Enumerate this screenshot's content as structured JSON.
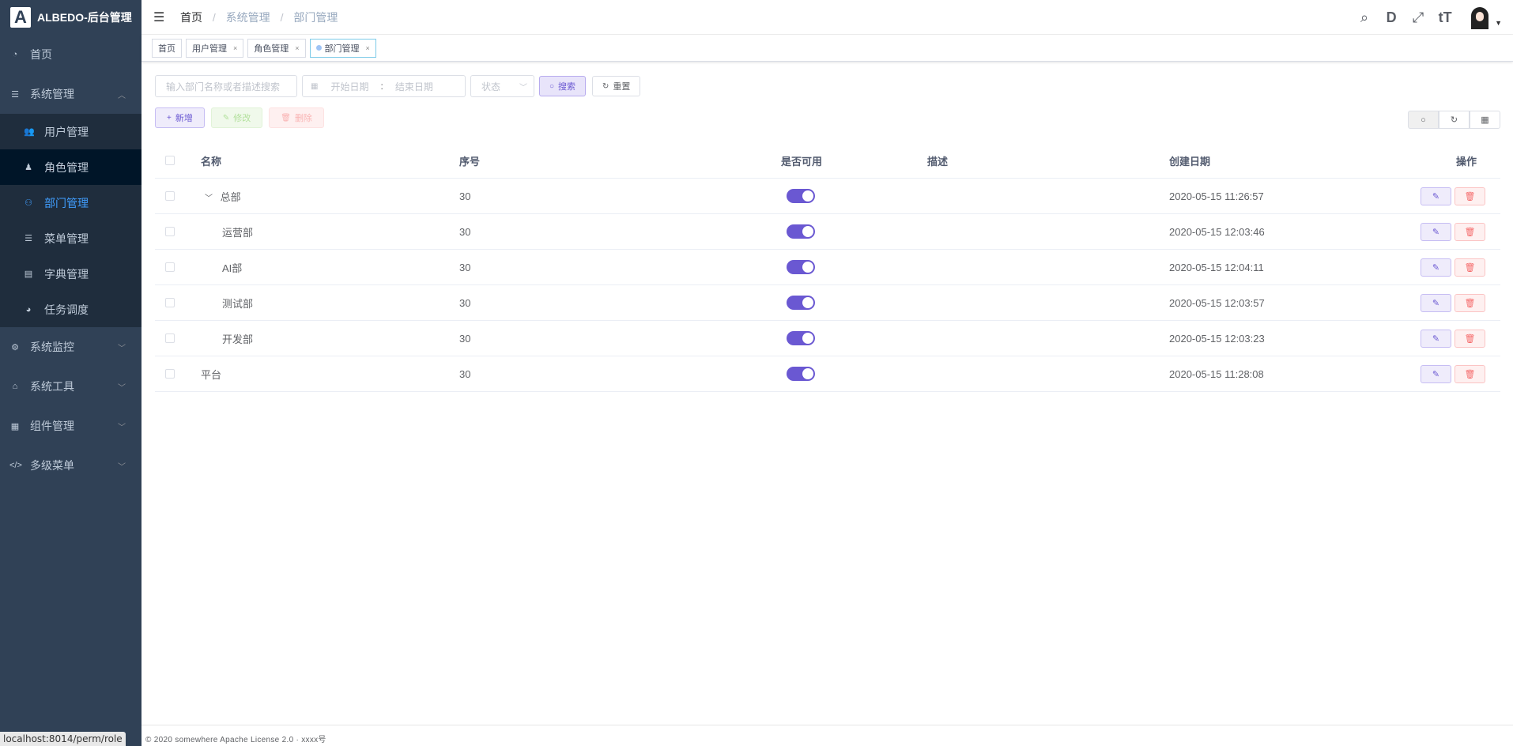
{
  "app": {
    "logo_letter": "A",
    "title": "ALBEDO-后台管理"
  },
  "sidebar": {
    "items": [
      {
        "label": "首页",
        "icon": "dashboard-icon"
      },
      {
        "label": "系统管理",
        "icon": "system-icon",
        "expanded": true,
        "children": [
          {
            "label": "用户管理",
            "icon": "user-icon"
          },
          {
            "label": "角色管理",
            "icon": "role-icon"
          },
          {
            "label": "部门管理",
            "icon": "dept-icon",
            "active": true
          },
          {
            "label": "菜单管理",
            "icon": "menu-icon"
          },
          {
            "label": "字典管理",
            "icon": "dict-icon"
          },
          {
            "label": "任务调度",
            "icon": "timer-icon"
          }
        ]
      },
      {
        "label": "系统监控",
        "icon": "monitor-icon"
      },
      {
        "label": "系统工具",
        "icon": "tool-icon"
      },
      {
        "label": "组件管理",
        "icon": "component-icon"
      },
      {
        "label": "多级菜单",
        "icon": "code-icon"
      }
    ]
  },
  "status_url": "localhost:8014/perm/role",
  "breadcrumb": {
    "home": "首页",
    "sep": "/",
    "level1": "系统管理",
    "level2": "部门管理"
  },
  "tags": [
    {
      "label": "首页"
    },
    {
      "label": "用户管理",
      "close": "×"
    },
    {
      "label": "角色管理",
      "close": "×"
    },
    {
      "label": "部门管理",
      "close": "×",
      "active": true
    }
  ],
  "filters": {
    "search_placeholder": "输入部门名称或者描述搜索",
    "start_placeholder": "开始日期",
    "range_sep": ":",
    "end_placeholder": "结束日期",
    "status_placeholder": "状态",
    "search_label": "搜索",
    "reset_label": "重置"
  },
  "crud": {
    "add_label": "新增",
    "edit_label": "修改",
    "delete_label": "删除"
  },
  "table": {
    "headers": {
      "name": "名称",
      "seq": "序号",
      "enabled": "是否可用",
      "desc": "描述",
      "date": "创建日期",
      "ops": "操作"
    },
    "rows": [
      {
        "name": "总部",
        "seq": "30",
        "enabled": true,
        "desc": "",
        "date": "2020-05-15 11:26:57",
        "level": 0,
        "expandable": true
      },
      {
        "name": "运营部",
        "seq": "30",
        "enabled": true,
        "desc": "",
        "date": "2020-05-15 12:03:46",
        "level": 1
      },
      {
        "name": "AI部",
        "seq": "30",
        "enabled": true,
        "desc": "",
        "date": "2020-05-15 12:04:11",
        "level": 1
      },
      {
        "name": "测试部",
        "seq": "30",
        "enabled": true,
        "desc": "",
        "date": "2020-05-15 12:03:57",
        "level": 1
      },
      {
        "name": "开发部",
        "seq": "30",
        "enabled": true,
        "desc": "",
        "date": "2020-05-15 12:03:23",
        "level": 1
      },
      {
        "name": "平台",
        "seq": "30",
        "enabled": true,
        "desc": "",
        "date": "2020-05-15 11:28:08",
        "level": 0
      }
    ]
  },
  "footer": "© 2020 somewhere Apache License 2.0 · xxxx号",
  "colors": {
    "sidebar_bg": "#304156",
    "submenu_bg": "#1f2d3d",
    "active": "#409eff",
    "primary": "#6a58d2"
  }
}
